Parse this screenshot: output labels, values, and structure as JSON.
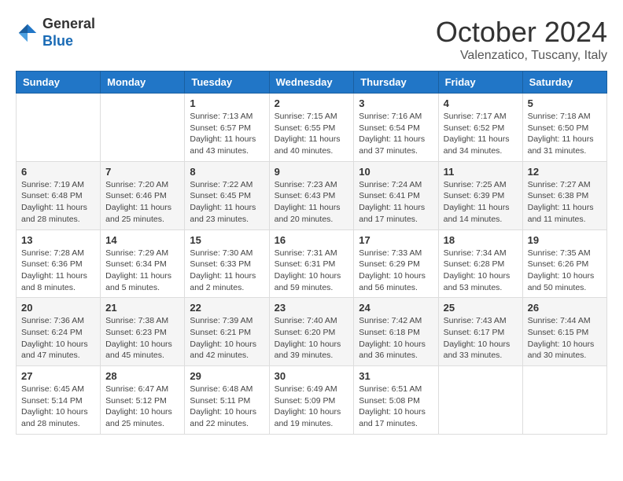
{
  "header": {
    "logo_general": "General",
    "logo_blue": "Blue",
    "month_title": "October 2024",
    "location": "Valenzatico, Tuscany, Italy"
  },
  "weekdays": [
    "Sunday",
    "Monday",
    "Tuesday",
    "Wednesday",
    "Thursday",
    "Friday",
    "Saturday"
  ],
  "weeks": [
    [
      null,
      null,
      {
        "day": "1",
        "sunrise": "7:13 AM",
        "sunset": "6:57 PM",
        "daylight": "11 hours and 43 minutes."
      },
      {
        "day": "2",
        "sunrise": "7:15 AM",
        "sunset": "6:55 PM",
        "daylight": "11 hours and 40 minutes."
      },
      {
        "day": "3",
        "sunrise": "7:16 AM",
        "sunset": "6:54 PM",
        "daylight": "11 hours and 37 minutes."
      },
      {
        "day": "4",
        "sunrise": "7:17 AM",
        "sunset": "6:52 PM",
        "daylight": "11 hours and 34 minutes."
      },
      {
        "day": "5",
        "sunrise": "7:18 AM",
        "sunset": "6:50 PM",
        "daylight": "11 hours and 31 minutes."
      }
    ],
    [
      {
        "day": "6",
        "sunrise": "7:19 AM",
        "sunset": "6:48 PM",
        "daylight": "11 hours and 28 minutes."
      },
      {
        "day": "7",
        "sunrise": "7:20 AM",
        "sunset": "6:46 PM",
        "daylight": "11 hours and 25 minutes."
      },
      {
        "day": "8",
        "sunrise": "7:22 AM",
        "sunset": "6:45 PM",
        "daylight": "11 hours and 23 minutes."
      },
      {
        "day": "9",
        "sunrise": "7:23 AM",
        "sunset": "6:43 PM",
        "daylight": "11 hours and 20 minutes."
      },
      {
        "day": "10",
        "sunrise": "7:24 AM",
        "sunset": "6:41 PM",
        "daylight": "11 hours and 17 minutes."
      },
      {
        "day": "11",
        "sunrise": "7:25 AM",
        "sunset": "6:39 PM",
        "daylight": "11 hours and 14 minutes."
      },
      {
        "day": "12",
        "sunrise": "7:27 AM",
        "sunset": "6:38 PM",
        "daylight": "11 hours and 11 minutes."
      }
    ],
    [
      {
        "day": "13",
        "sunrise": "7:28 AM",
        "sunset": "6:36 PM",
        "daylight": "11 hours and 8 minutes."
      },
      {
        "day": "14",
        "sunrise": "7:29 AM",
        "sunset": "6:34 PM",
        "daylight": "11 hours and 5 minutes."
      },
      {
        "day": "15",
        "sunrise": "7:30 AM",
        "sunset": "6:33 PM",
        "daylight": "11 hours and 2 minutes."
      },
      {
        "day": "16",
        "sunrise": "7:31 AM",
        "sunset": "6:31 PM",
        "daylight": "10 hours and 59 minutes."
      },
      {
        "day": "17",
        "sunrise": "7:33 AM",
        "sunset": "6:29 PM",
        "daylight": "10 hours and 56 minutes."
      },
      {
        "day": "18",
        "sunrise": "7:34 AM",
        "sunset": "6:28 PM",
        "daylight": "10 hours and 53 minutes."
      },
      {
        "day": "19",
        "sunrise": "7:35 AM",
        "sunset": "6:26 PM",
        "daylight": "10 hours and 50 minutes."
      }
    ],
    [
      {
        "day": "20",
        "sunrise": "7:36 AM",
        "sunset": "6:24 PM",
        "daylight": "10 hours and 47 minutes."
      },
      {
        "day": "21",
        "sunrise": "7:38 AM",
        "sunset": "6:23 PM",
        "daylight": "10 hours and 45 minutes."
      },
      {
        "day": "22",
        "sunrise": "7:39 AM",
        "sunset": "6:21 PM",
        "daylight": "10 hours and 42 minutes."
      },
      {
        "day": "23",
        "sunrise": "7:40 AM",
        "sunset": "6:20 PM",
        "daylight": "10 hours and 39 minutes."
      },
      {
        "day": "24",
        "sunrise": "7:42 AM",
        "sunset": "6:18 PM",
        "daylight": "10 hours and 36 minutes."
      },
      {
        "day": "25",
        "sunrise": "7:43 AM",
        "sunset": "6:17 PM",
        "daylight": "10 hours and 33 minutes."
      },
      {
        "day": "26",
        "sunrise": "7:44 AM",
        "sunset": "6:15 PM",
        "daylight": "10 hours and 30 minutes."
      }
    ],
    [
      {
        "day": "27",
        "sunrise": "6:45 AM",
        "sunset": "5:14 PM",
        "daylight": "10 hours and 28 minutes."
      },
      {
        "day": "28",
        "sunrise": "6:47 AM",
        "sunset": "5:12 PM",
        "daylight": "10 hours and 25 minutes."
      },
      {
        "day": "29",
        "sunrise": "6:48 AM",
        "sunset": "5:11 PM",
        "daylight": "10 hours and 22 minutes."
      },
      {
        "day": "30",
        "sunrise": "6:49 AM",
        "sunset": "5:09 PM",
        "daylight": "10 hours and 19 minutes."
      },
      {
        "day": "31",
        "sunrise": "6:51 AM",
        "sunset": "5:08 PM",
        "daylight": "10 hours and 17 minutes."
      },
      null,
      null
    ]
  ]
}
